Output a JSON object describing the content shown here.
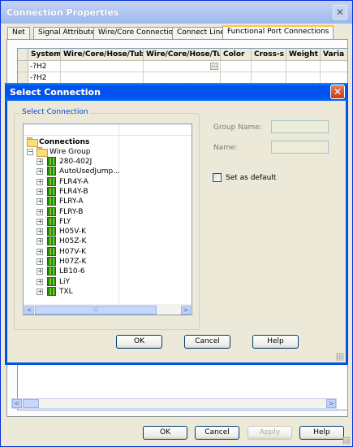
{
  "back_window": {
    "title": "Connection Properties",
    "tabs": [
      "Net",
      "Signal Attributes",
      "Wire/Core Connections",
      "Connect Lines",
      "Functional Port Connections"
    ],
    "active_tab": "Functional Port Connections",
    "table": {
      "columns": [
        "System",
        "Wire/Core/Hose/Tube",
        "Wire/Core/Hose/Tub",
        "Color",
        "Cross-s",
        "Weight",
        "Varia"
      ],
      "rows": [
        {
          "system": "-?H2",
          "ellipsis": "..."
        },
        {
          "system": "-?H2"
        }
      ]
    },
    "scroll_left": "<",
    "scroll_right": ">",
    "buttons": {
      "ok": "OK",
      "cancel": "Cancel",
      "apply": "Apply",
      "help": "Help"
    }
  },
  "dialog": {
    "title": "Select Connection",
    "group_label": "Select Connection",
    "tree": {
      "root": "Connections",
      "group": "Wire Group",
      "items": [
        "280-402J",
        "AutoUsedJump...",
        "FLR4Y-A",
        "FLR4Y-B",
        "FLRY-A",
        "FLRY-B",
        "FLY",
        "H05V-K",
        "H05Z-K",
        "H07V-K",
        "H07Z-K",
        "LB10-6",
        "LiY",
        "TXL"
      ]
    },
    "group_name_label": "Group Name:",
    "group_name_value": "",
    "name_label": "Name:",
    "name_value": "",
    "set_as_default_label": "Set as default",
    "set_as_default_checked": false,
    "buttons": {
      "ok": "OK",
      "cancel": "Cancel",
      "help": "Help"
    },
    "scroll_left": "<",
    "scroll_right": ">"
  },
  "icons": {
    "close": "close-icon",
    "folder": "folder-icon",
    "wire": "wire-icon",
    "expand": "plus-icon",
    "collapse": "minus-icon"
  }
}
